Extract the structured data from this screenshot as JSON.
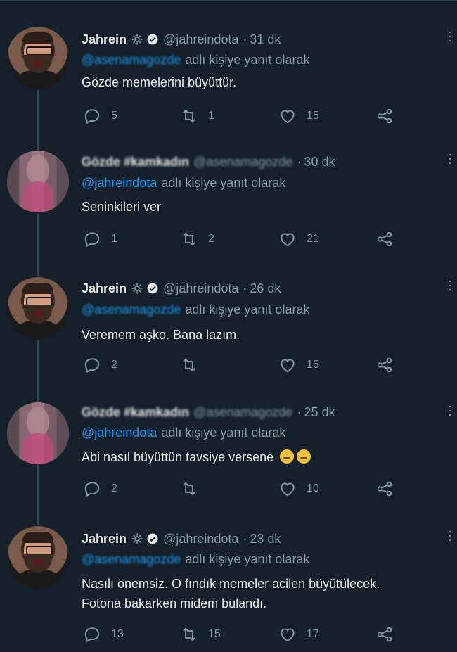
{
  "tweets": [
    {
      "author": "Jahrein",
      "handle": "@jahreindota",
      "time": "31 dk",
      "reply_mention": "@asenamagozde",
      "reply_rest": "adlı kişiye yanıt olarak",
      "text": "Gözde memelerini büyüttür.",
      "replies": "5",
      "retweets": "1",
      "likes": "15"
    },
    {
      "author": "Gözde #kamkadın",
      "handle": "@asenamagozde",
      "time": "30 dk",
      "reply_mention": "@jahreindota",
      "reply_rest": "adlı kişiye yanıt olarak",
      "text": "Seninkileri ver",
      "replies": "1",
      "retweets": "2",
      "likes": "21"
    },
    {
      "author": "Jahrein",
      "handle": "@jahreindota",
      "time": "26 dk",
      "reply_mention": "@asenamagozde",
      "reply_rest": "adlı kişiye yanıt olarak",
      "text": "Veremem aşko. Bana lazım.",
      "replies": "2",
      "retweets": "",
      "likes": "15"
    },
    {
      "author": "Gözde #kamkadın",
      "handle": "@asenamagozde",
      "time": "25 dk",
      "reply_mention": "@jahreindota",
      "reply_rest": "adlı kişiye yanıt olarak",
      "text": "Abi nasıl büyüttün tavsiye versene",
      "replies": "2",
      "retweets": "",
      "likes": "10"
    },
    {
      "author": "Jahrein",
      "handle": "@jahreindota",
      "time": "23 dk",
      "reply_mention": "@asenamagozde",
      "reply_rest": "adlı kişiye yanıt olarak",
      "text_line1": "Nasılı önemsiz. O fındık memeler acilen büyütülecek.",
      "text_line2": "Fotona bakarken midem bulandı.",
      "replies": "13",
      "retweets": "15",
      "likes": "17"
    }
  ],
  "separator": "·",
  "colors": {
    "background": "#15202b",
    "secondary_text": "#8b98a5",
    "link": "#1d9bf0",
    "verified": "#e7e9ea"
  },
  "icons": [
    "gear-icon",
    "verified-badge-icon",
    "reply-icon",
    "retweet-icon",
    "like-icon",
    "share-icon",
    "more-icon",
    "emoji-icon"
  ]
}
